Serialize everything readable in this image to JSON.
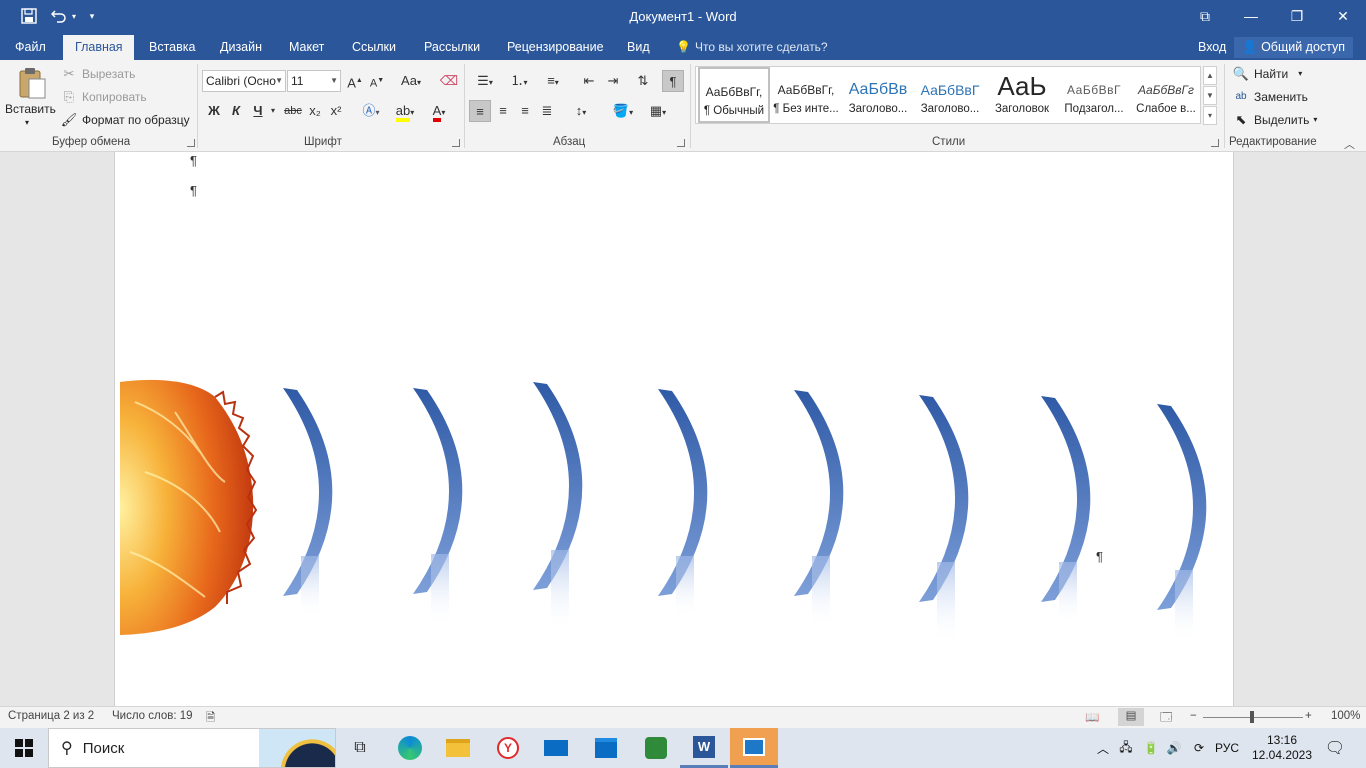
{
  "window": {
    "title": "Документ1 - Word",
    "controls": {
      "restore_ribbon": "⧉",
      "minimize": "—",
      "maximize": "❐",
      "close": "✕"
    }
  },
  "tabs": [
    {
      "label": "Файл"
    },
    {
      "label": "Главная"
    },
    {
      "label": "Вставка"
    },
    {
      "label": "Дизайн"
    },
    {
      "label": "Макет"
    },
    {
      "label": "Ссылки"
    },
    {
      "label": "Рассылки"
    },
    {
      "label": "Рецензирование"
    },
    {
      "label": "Вид"
    }
  ],
  "tell_me": "Что вы хотите сделать?",
  "signin": "Вход",
  "share": "Общий доступ",
  "clipboard": {
    "paste": "Вставить",
    "cut": "Вырезать",
    "copy": "Копировать",
    "format_painter": "Формат по образцу",
    "label": "Буфер обмена"
  },
  "font": {
    "name": "Calibri (Осно",
    "size": "11",
    "label": "Шрифт",
    "bold": "Ж",
    "italic": "К",
    "underline": "Ч",
    "strike": "abc",
    "sub": "x₂",
    "sup": "x²",
    "grow": "A",
    "shrink": "A",
    "case": "Aa"
  },
  "paragraph": {
    "label": "Абзац"
  },
  "styles": {
    "label": "Стили",
    "items": [
      {
        "preview": "АаБбВвГг,",
        "name": "¶ Обычный"
      },
      {
        "preview": "АаБбВвГг,",
        "name": "¶ Без инте..."
      },
      {
        "preview": "АаБбВв",
        "name": "Заголово..."
      },
      {
        "preview": "АаБбВвГ",
        "name": "Заголово..."
      },
      {
        "preview": "АаЬ",
        "name": "Заголовок"
      },
      {
        "preview": "АаБбВвГ",
        "name": "Подзагол..."
      },
      {
        "preview": "АаБбВвГг",
        "name": "Слабое в..."
      }
    ]
  },
  "editing": {
    "label": "Редактирование",
    "find": "Найти",
    "replace": "Заменить",
    "select": "Выделить"
  },
  "document": {
    "pilcrow": "¶"
  },
  "status": {
    "page": "Страница 2 из 2",
    "words": "Число слов: 19",
    "zoom": "100%"
  },
  "taskbar": {
    "search_placeholder": "Поиск",
    "lang": "РУС",
    "time": "13:16",
    "date": "12.04.2023"
  },
  "colors": {
    "accent": "#2b579a",
    "wave_top": "#2f5aa6",
    "wave_bottom": "#7d9fd9",
    "highlight": "#ffff00",
    "font_color": "#e00000"
  }
}
